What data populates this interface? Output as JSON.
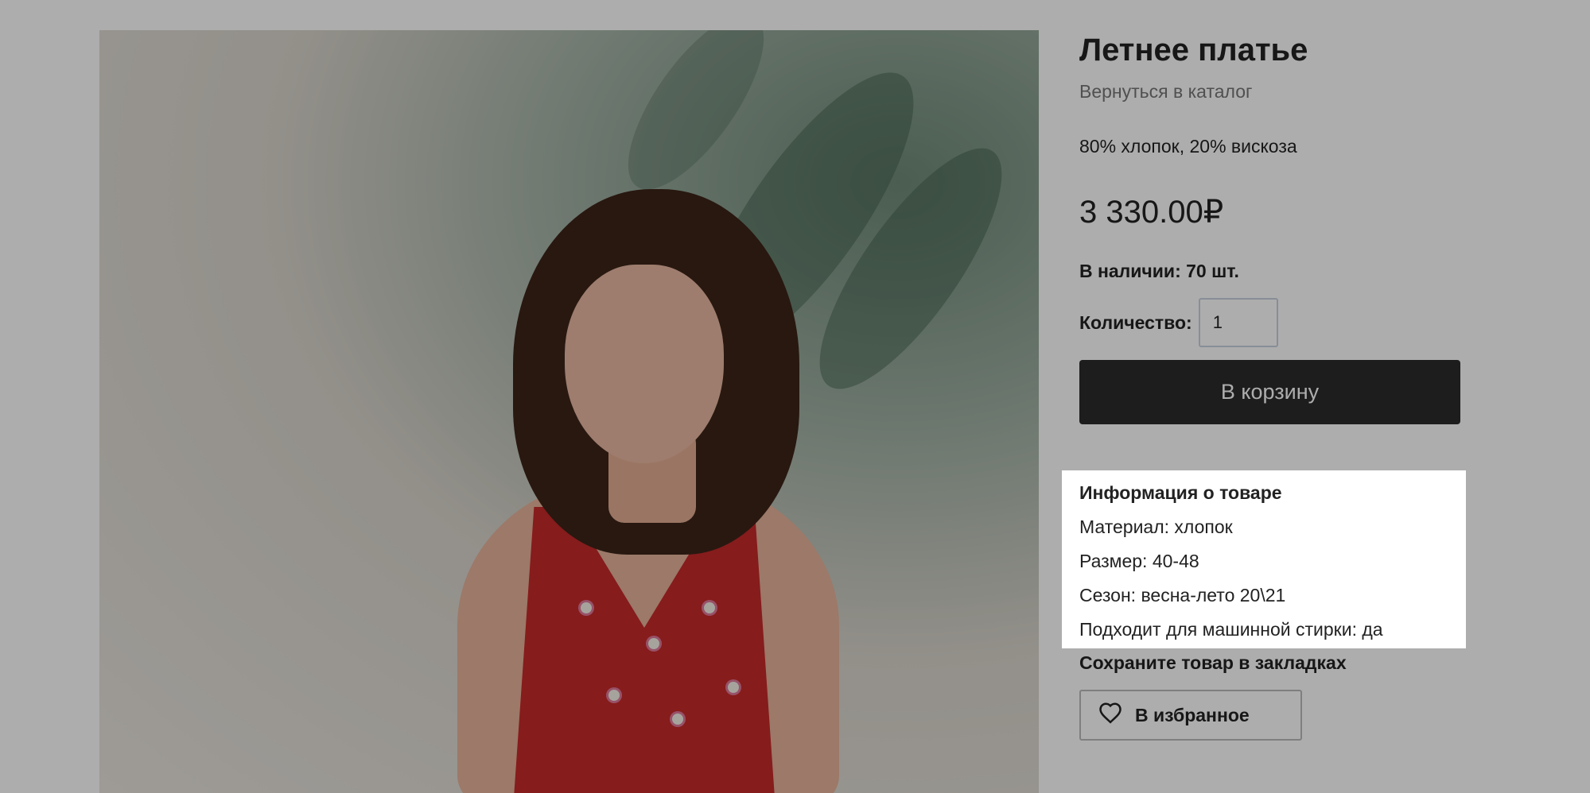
{
  "product": {
    "title": "Летнее платье",
    "back_link": "Вернуться в каталог",
    "composition": "80% хлопок, 20% вискоза",
    "price": "3 330.00₽",
    "stock": "В наличии: 70 шт.",
    "quantity_label": "Количество:",
    "quantity_value": "1",
    "add_to_cart": "В корзину"
  },
  "info": {
    "title": "Информация о товаре",
    "lines": [
      "Материал: хлопок",
      "Размер: 40-48",
      "Сезон: весна-лето 20\\21",
      "Подходит для машинной стирки: да"
    ]
  },
  "bookmarks": {
    "title": "Сохраните товар в закладках",
    "favorite_button": "В избранное",
    "favorite_icon": "heart-icon"
  },
  "colors": {
    "cart_button": "#2b2b2b",
    "overlay": "rgba(0,0,0,0.32)",
    "dress": "#c62a2a"
  }
}
